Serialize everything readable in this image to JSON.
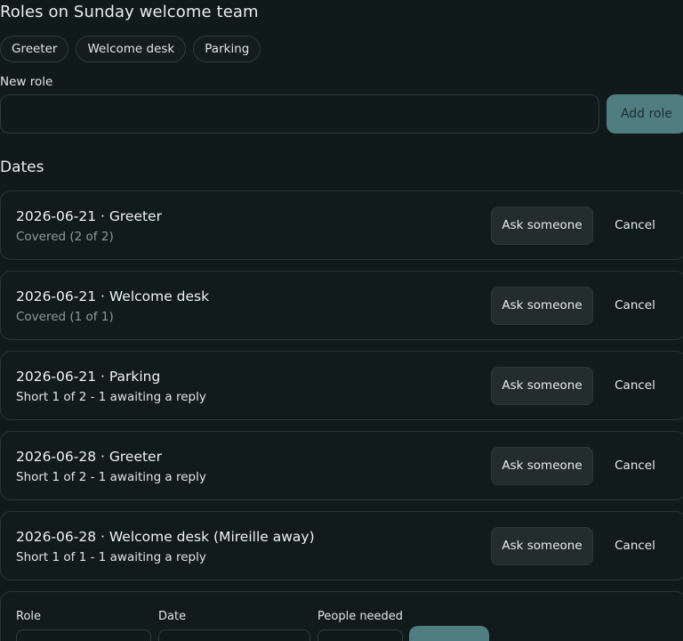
{
  "header": {
    "title": "Roles on Sunday welcome team"
  },
  "roles": [
    "Greeter",
    "Welcome desk",
    "Parking"
  ],
  "new_role": {
    "label": "New role",
    "value": "",
    "button_label": "Add role"
  },
  "dates": {
    "heading": "Dates",
    "ask_label": "Ask someone",
    "cancel_label": "Cancel",
    "items": [
      {
        "title": "2026-06-21 · Greeter",
        "status": "Covered (2 of 2)",
        "state": "covered"
      },
      {
        "title": "2026-06-21 · Welcome desk",
        "status": "Covered (1 of 1)",
        "state": "covered"
      },
      {
        "title": "2026-06-21 · Parking",
        "status": "Short 1 of 2 - 1 awaiting a reply",
        "state": "short"
      },
      {
        "title": "2026-06-28 · Greeter",
        "status": "Short 1 of 2 - 1 awaiting a reply",
        "state": "short"
      },
      {
        "title": "2026-06-28 · Welcome desk (Mireille away)",
        "status": "Short 1 of 1 - 1 awaiting a reply",
        "state": "short"
      }
    ]
  },
  "add_date_form": {
    "role_label": "Role",
    "date_label": "Date",
    "people_needed_label": "People needed"
  },
  "colors": {
    "background": "#111a1a",
    "accent": "#4f7d80",
    "muted_text": "#8d9a98"
  }
}
